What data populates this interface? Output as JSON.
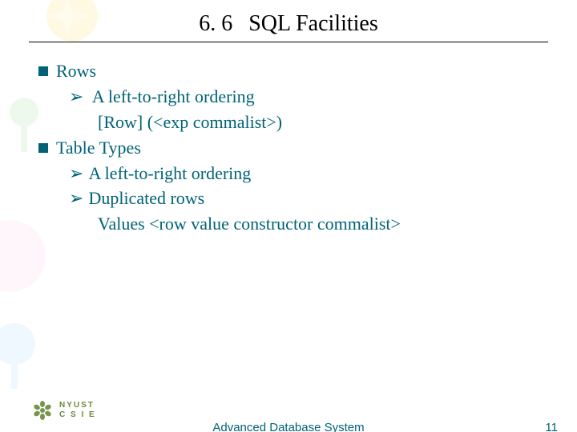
{
  "title": {
    "number": "6. 6",
    "text": "SQL Facilities"
  },
  "bullets": {
    "b1": "Rows",
    "b1_s1": "A left-to-right ordering",
    "b1_s1_l1": "[Row] (<exp commalist>)",
    "b2": "Table Types",
    "b2_s1": "A left-to-right ordering",
    "b2_s2": "Duplicated rows",
    "b2_s2_l1": "Values <row value constructor commalist>"
  },
  "footer": {
    "center": "Advanced Database System",
    "page": "11"
  },
  "logo": {
    "line1": "NYUST",
    "line2": "C S I E"
  },
  "colors": {
    "accent": "#006277",
    "logo": "#6a8a3a"
  }
}
